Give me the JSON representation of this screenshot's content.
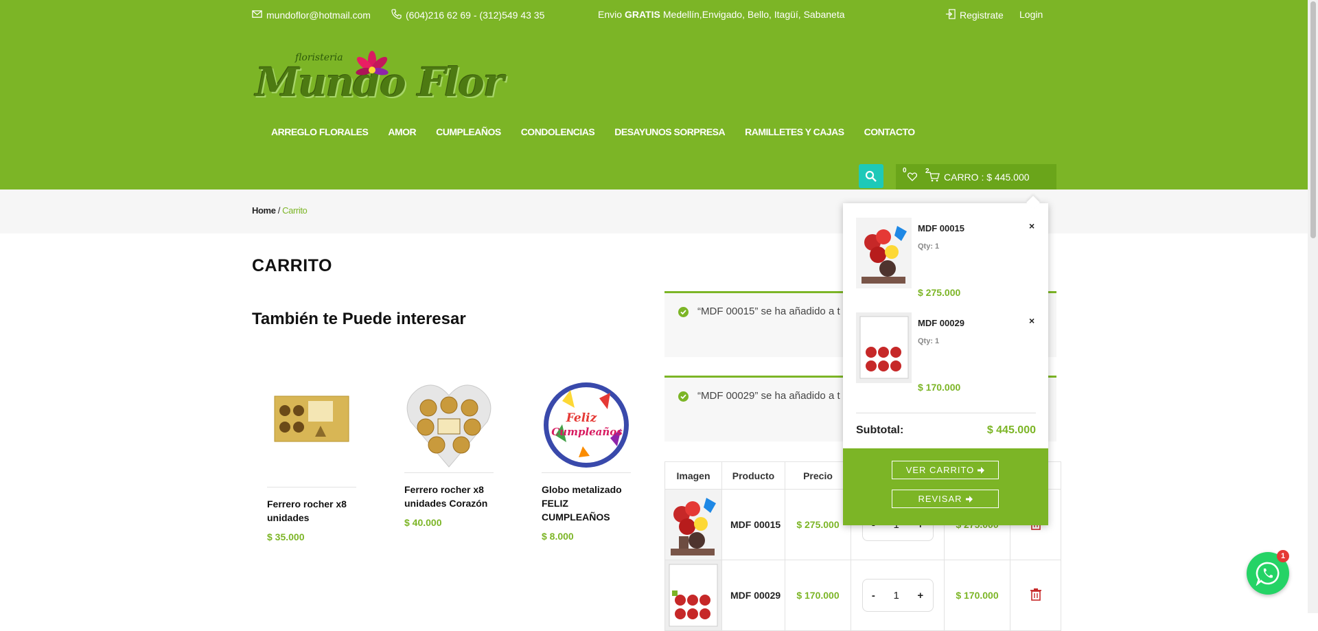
{
  "topbar": {
    "email": "mundoflor@hotmail.com",
    "phones": "(604)216 62 69 - (312)549 43 35",
    "envio_prefix": "Envio",
    "envio_bold": "GRATIS",
    "envio_cities": "Medellín,Envigado, Bello, Itagüí, Sabaneta",
    "register": "Registrate",
    "login": "Login"
  },
  "logo": {
    "small": "floristeria",
    "main": "Mundo Flor"
  },
  "nav": [
    "ARREGLO FLORALES",
    "AMOR",
    "CUMPLEAÑOS",
    "CONDOLENCIAS",
    "DESAYUNOS SORPRESA",
    "RAMILLETES Y CAJAS",
    "CONTACTO"
  ],
  "cart_bar": {
    "wishlist_count": "0",
    "cart_count": "2",
    "label": "CARRO : $ 445.000"
  },
  "breadcrumb": {
    "home": "Home",
    "sep": " / ",
    "current": "Carrito"
  },
  "page_title": "CARRITO",
  "related_title": "También te Puede interesar",
  "related": [
    {
      "name": "Ferrero rocher x8 unidades",
      "price": "$ 35.000"
    },
    {
      "name": "Ferrero rocher x8 unidades Corazón",
      "price": "$ 40.000"
    },
    {
      "name": "Globo metalizado FELIZ CUMPLEAÑOS",
      "price": "$ 8.000",
      "balloon_text1": "Feliz",
      "balloon_text2": "Cumpleaños"
    }
  ],
  "notices": [
    "“MDF 00015” se ha añadido a t",
    "“MDF 00029” se ha añadido a t"
  ],
  "table": {
    "headers": [
      "Imagen",
      "Producto",
      "Precio"
    ],
    "rows": [
      {
        "product": "MDF 00015",
        "price": "$ 275.000",
        "qty": "1",
        "subtotal": "$ 275.000"
      },
      {
        "product": "MDF 00029",
        "price": "$ 170.000",
        "qty": "1",
        "subtotal": "$ 170.000"
      }
    ],
    "minus": "-",
    "plus": "+"
  },
  "mini_cart": {
    "items": [
      {
        "name": "MDF 00015",
        "qty": "Qty: 1",
        "price": "$ 275.000"
      },
      {
        "name": "MDF 00029",
        "qty": "Qty: 1",
        "price": "$ 170.000"
      }
    ],
    "remove": "×",
    "subtotal_label": "Subtotal:",
    "subtotal_value": "$ 445.000",
    "view_cart": "VER CARRITO",
    "checkout": "REVISAR"
  },
  "whatsapp_badge": "1",
  "colors": {
    "brand_green": "#7cb526",
    "search_teal": "#1ec9b8",
    "whatsapp": "#25d366"
  }
}
